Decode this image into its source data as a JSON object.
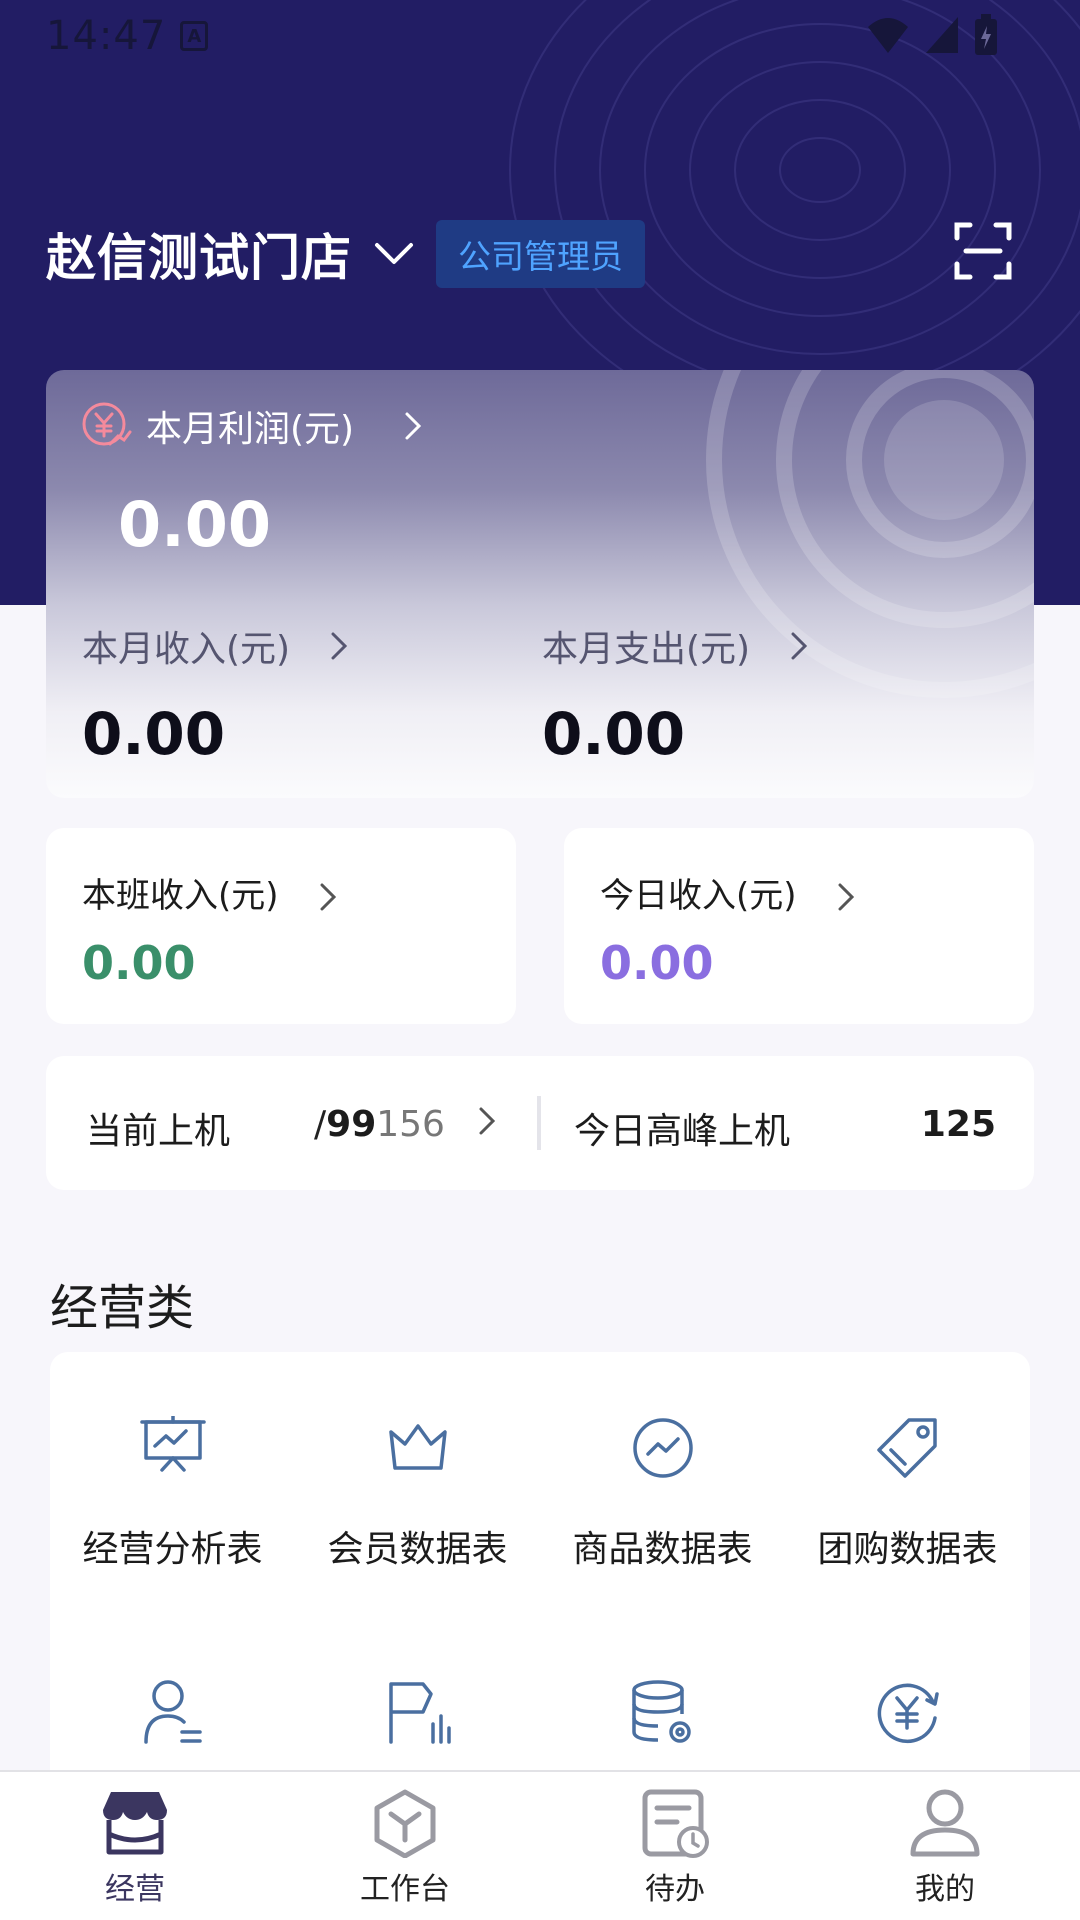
{
  "status_bar": {
    "time": "14:47",
    "notif": "A"
  },
  "header": {
    "store_name": "赵信测试门店",
    "role_badge": "公司管理员"
  },
  "profit_card": {
    "profit_label": "本月利润(元)",
    "profit_value": "0.00",
    "income_label": "本月收入(元)",
    "income_value": "0.00",
    "expense_label": "本月支出(元)",
    "expense_value": "0.00"
  },
  "shift_card": {
    "label": "本班收入(元)",
    "value": "0.00"
  },
  "today_card": {
    "label": "今日收入(元)",
    "value": "0.00"
  },
  "online_card": {
    "current_label": "当前上机",
    "current_sep": "/",
    "current_value": "99",
    "current_total": "156",
    "peak_label": "今日高峰上机",
    "peak_value": "125"
  },
  "section": {
    "title": "经营类",
    "items": [
      {
        "label": "经营分析表",
        "icon": "presentation-chart-icon"
      },
      {
        "label": "会员数据表",
        "icon": "crown-icon"
      },
      {
        "label": "商品数据表",
        "icon": "trend-circle-icon"
      },
      {
        "label": "团购数据表",
        "icon": "tag-icon"
      },
      {
        "label": "",
        "icon": "user-list-icon"
      },
      {
        "label": "",
        "icon": "flag-bars-icon"
      },
      {
        "label": "",
        "icon": "database-gear-icon"
      },
      {
        "label": "",
        "icon": "yuan-refresh-icon"
      }
    ]
  },
  "bottom_nav": {
    "items": [
      {
        "label": "经营",
        "icon": "store-icon",
        "active": true
      },
      {
        "label": "工作台",
        "icon": "cube-icon",
        "active": false
      },
      {
        "label": "待办",
        "icon": "todo-clock-icon",
        "active": false
      },
      {
        "label": "我的",
        "icon": "person-icon",
        "active": false
      }
    ]
  },
  "colors": {
    "header_bg": "#221d64",
    "badge_bg": "#1f3b84",
    "badge_text": "#4fa3ff",
    "shift_value": "#3a8f6a",
    "today_value": "#8a6ee0",
    "icon_blue": "#4a6fa0"
  }
}
